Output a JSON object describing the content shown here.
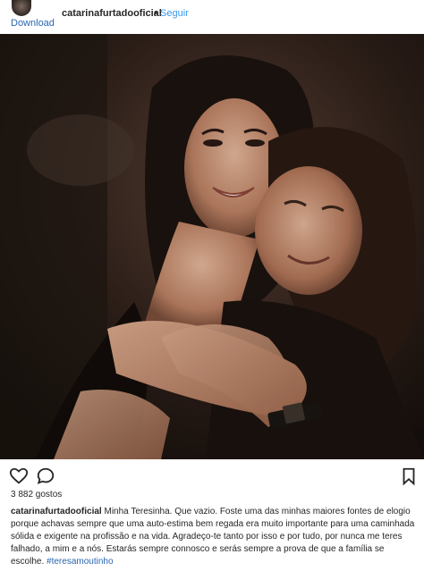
{
  "header": {
    "username": "catarinafurtadooficial",
    "separator": "•",
    "follow_label": "Seguir",
    "download_label": "Download"
  },
  "post": {
    "likes": "3 882 gostos",
    "caption_user": "catarinafurtadooficial",
    "caption_text": "Minha Teresinha. Que vazio. Foste uma das minhas maiores fontes de elogio porque achavas sempre que uma auto-estima bem regada era muito importante para uma caminhada sólida e exigente na profissão e na vida. Agradeço-te tanto por isso e por tudo, por nunca me teres falhado, a mim e a nós. Estarás sempre connosco e serás sempre a prova de que a família se escolhe.",
    "hashtag": "#teresamoutinho"
  },
  "icons": {
    "like": "heart-icon",
    "comment": "comment-icon",
    "save": "bookmark-icon"
  },
  "colors": {
    "link": "#3897f0",
    "download_link": "#2a66b0",
    "text": "#262626"
  }
}
